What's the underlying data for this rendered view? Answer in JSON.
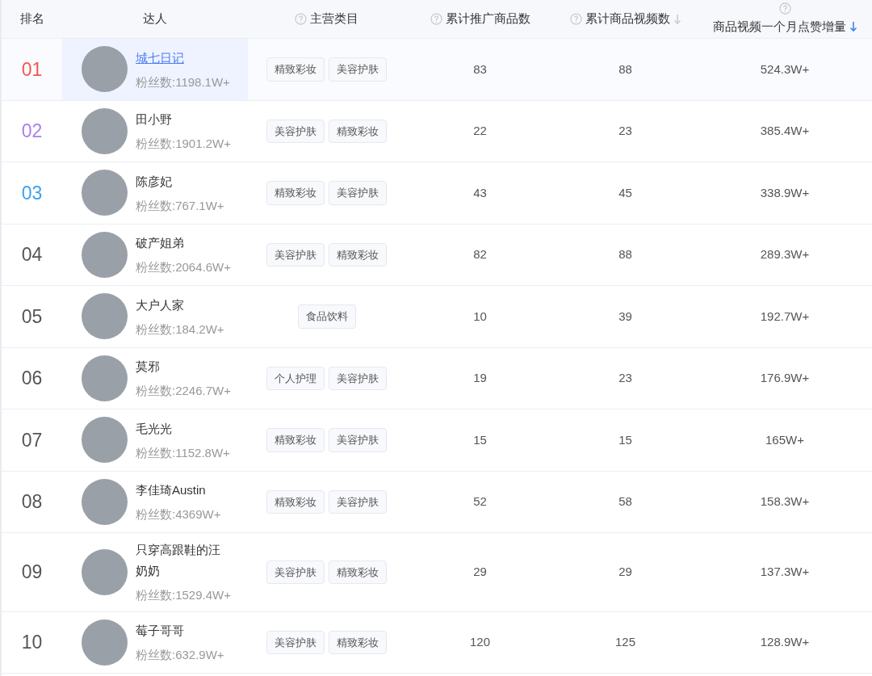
{
  "columns": [
    {
      "label": "排名",
      "help": false,
      "sortable": false,
      "sorted": false
    },
    {
      "label": "达人",
      "help": false,
      "sortable": false,
      "sorted": false
    },
    {
      "label": "主营类目",
      "help": true,
      "sortable": false,
      "sorted": false
    },
    {
      "label": "累计推广商品数",
      "help": true,
      "sortable": false,
      "sorted": false
    },
    {
      "label": "累计商品视频数",
      "help": true,
      "sortable": true,
      "sorted": false
    },
    {
      "label": "商品视频一个月点赞增量",
      "help": true,
      "sortable": true,
      "sorted": true
    }
  ],
  "rows": [
    {
      "rank": "01",
      "color": "#f5554f",
      "selected": true,
      "name": "城七日记",
      "fans": "粉丝数:1198.1W+",
      "tags": [
        "精致彩妆",
        "美容护肤"
      ],
      "products": "83",
      "videos": "88",
      "likes": "524.3W+"
    },
    {
      "rank": "02",
      "color": "#a97ef0",
      "selected": false,
      "name": "田小野",
      "fans": "粉丝数:1901.2W+",
      "tags": [
        "美容护肤",
        "精致彩妆"
      ],
      "products": "22",
      "videos": "23",
      "likes": "385.4W+"
    },
    {
      "rank": "03",
      "color": "#3aa0f0",
      "selected": false,
      "name": "陈彦妃",
      "fans": "粉丝数:767.1W+",
      "tags": [
        "精致彩妆",
        "美容护肤"
      ],
      "products": "43",
      "videos": "45",
      "likes": "338.9W+"
    },
    {
      "rank": "04",
      "color": "#555555",
      "selected": false,
      "name": "破产姐弟",
      "fans": "粉丝数:2064.6W+",
      "tags": [
        "美容护肤",
        "精致彩妆"
      ],
      "products": "82",
      "videos": "88",
      "likes": "289.3W+"
    },
    {
      "rank": "05",
      "color": "#555555",
      "selected": false,
      "name": "大户人家",
      "fans": "粉丝数:184.2W+",
      "tags": [
        "食品饮料"
      ],
      "products": "10",
      "videos": "39",
      "likes": "192.7W+"
    },
    {
      "rank": "06",
      "color": "#555555",
      "selected": false,
      "name": "莫邪",
      "fans": "粉丝数:2246.7W+",
      "tags": [
        "个人护理",
        "美容护肤"
      ],
      "products": "19",
      "videos": "23",
      "likes": "176.9W+"
    },
    {
      "rank": "07",
      "color": "#555555",
      "selected": false,
      "name": "毛光光",
      "fans": "粉丝数:1152.8W+",
      "tags": [
        "精致彩妆",
        "美容护肤"
      ],
      "products": "15",
      "videos": "15",
      "likes": "165W+"
    },
    {
      "rank": "08",
      "color": "#555555",
      "selected": false,
      "name": "李佳琦Austin",
      "fans": "粉丝数:4369W+",
      "tags": [
        "精致彩妆",
        "美容护肤"
      ],
      "products": "52",
      "videos": "58",
      "likes": "158.3W+"
    },
    {
      "rank": "09",
      "color": "#555555",
      "selected": false,
      "name": "只穿高跟鞋的汪奶奶",
      "fans": "粉丝数:1529.4W+",
      "tags": [
        "美容护肤",
        "精致彩妆"
      ],
      "products": "29",
      "videos": "29",
      "likes": "137.3W+"
    },
    {
      "rank": "10",
      "color": "#555555",
      "selected": false,
      "name": "莓子哥哥",
      "fans": "粉丝数:632.9W+",
      "tags": [
        "美容护肤",
        "精致彩妆"
      ],
      "products": "120",
      "videos": "125",
      "likes": "128.9W+"
    }
  ]
}
